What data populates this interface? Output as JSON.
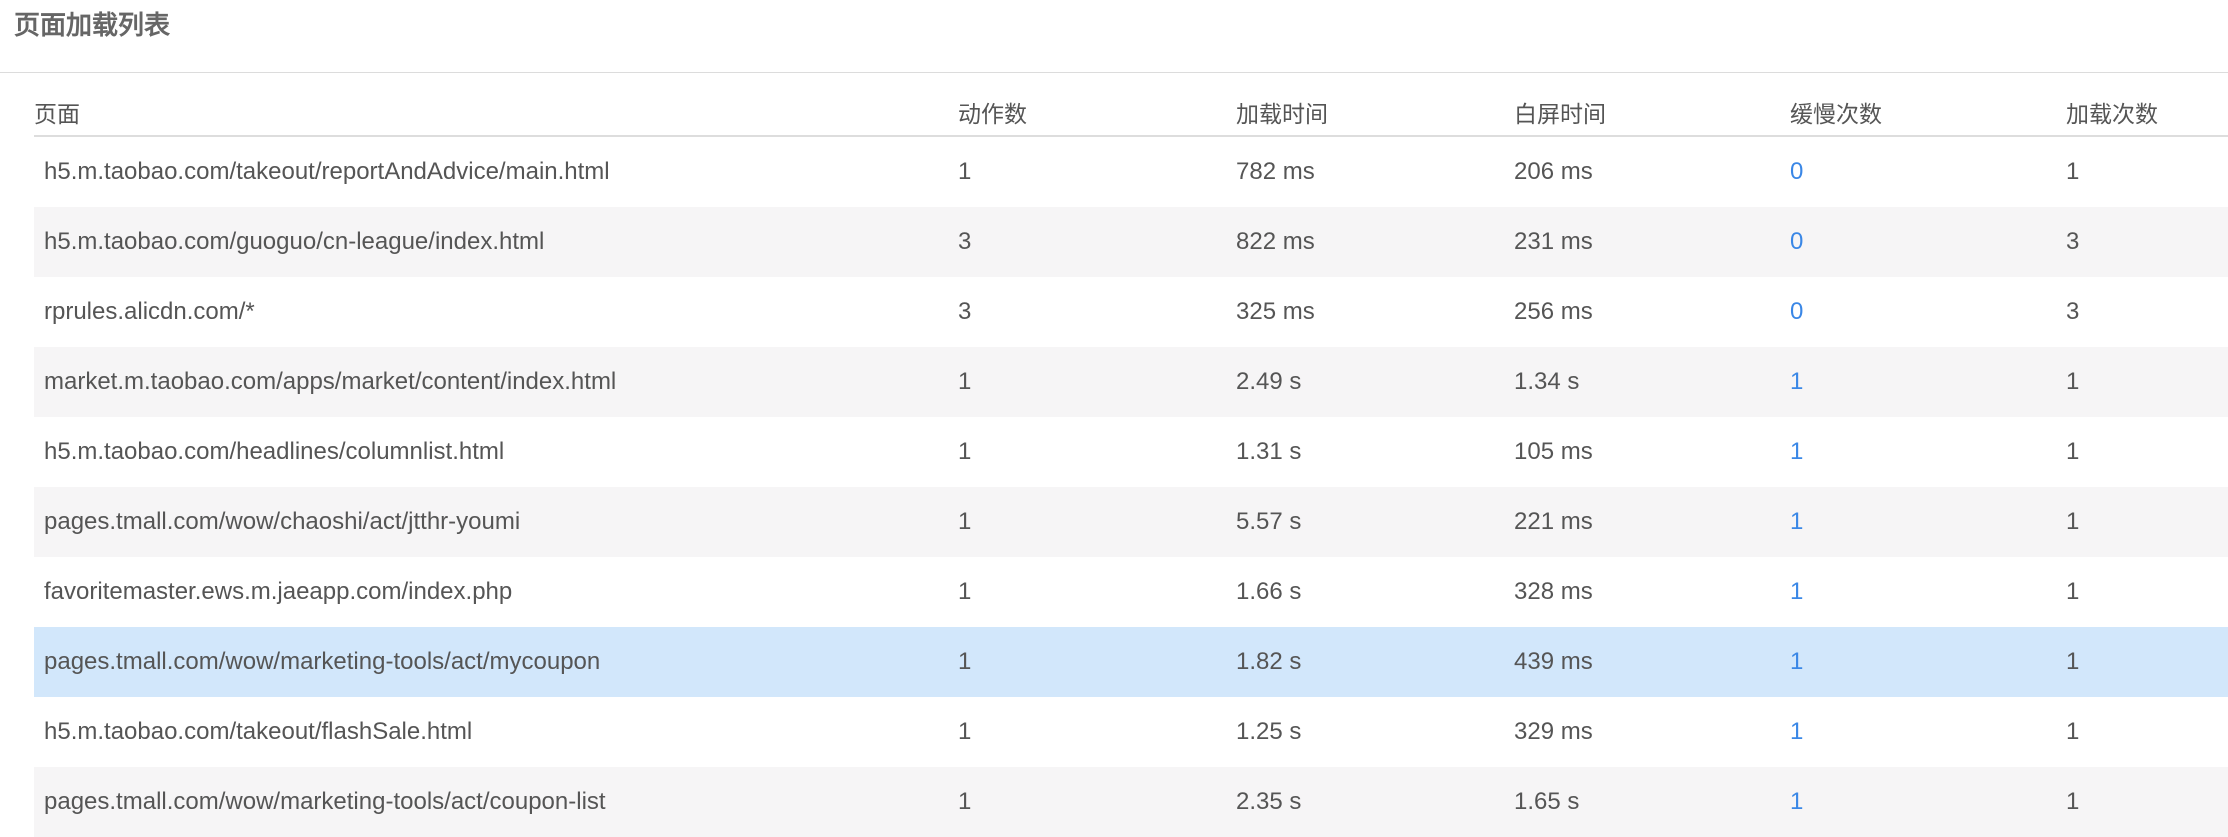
{
  "panel": {
    "title": "页面加载列表"
  },
  "table": {
    "columns": [
      "页面",
      "动作数",
      "加载时间",
      "白屏时间",
      "缓慢次数",
      "加载次数"
    ],
    "rows": [
      {
        "page": "h5.m.taobao.com/takeout/reportAndAdvice/main.html",
        "actions": "1",
        "load_time": "782 ms",
        "white_screen_time": "206 ms",
        "slow_count": "0",
        "load_count": "1"
      },
      {
        "page": "h5.m.taobao.com/guoguo/cn-league/index.html",
        "actions": "3",
        "load_time": "822 ms",
        "white_screen_time": "231 ms",
        "slow_count": "0",
        "load_count": "3"
      },
      {
        "page": "rprules.alicdn.com/*",
        "actions": "3",
        "load_time": "325 ms",
        "white_screen_time": "256 ms",
        "slow_count": "0",
        "load_count": "3"
      },
      {
        "page": "market.m.taobao.com/apps/market/content/index.html",
        "actions": "1",
        "load_time": "2.49 s",
        "white_screen_time": "1.34 s",
        "slow_count": "1",
        "load_count": "1"
      },
      {
        "page": "h5.m.taobao.com/headlines/columnlist.html",
        "actions": "1",
        "load_time": "1.31 s",
        "white_screen_time": "105 ms",
        "slow_count": "1",
        "load_count": "1"
      },
      {
        "page": "pages.tmall.com/wow/chaoshi/act/jtthr-youmi",
        "actions": "1",
        "load_time": "5.57 s",
        "white_screen_time": "221 ms",
        "slow_count": "1",
        "load_count": "1"
      },
      {
        "page": "favoritemaster.ews.m.jaeapp.com/index.php",
        "actions": "1",
        "load_time": "1.66 s",
        "white_screen_time": "328 ms",
        "slow_count": "1",
        "load_count": "1"
      },
      {
        "page": "pages.tmall.com/wow/marketing-tools/act/mycoupon",
        "actions": "1",
        "load_time": "1.82 s",
        "white_screen_time": "439 ms",
        "slow_count": "1",
        "load_count": "1"
      },
      {
        "page": "h5.m.taobao.com/takeout/flashSale.html",
        "actions": "1",
        "load_time": "1.25 s",
        "white_screen_time": "329 ms",
        "slow_count": "1",
        "load_count": "1"
      },
      {
        "page": "pages.tmall.com/wow/marketing-tools/act/coupon-list",
        "actions": "1",
        "load_time": "2.35 s",
        "white_screen_time": "1.65 s",
        "slow_count": "1",
        "load_count": "1"
      }
    ],
    "selected_row_index": 7
  },
  "colors": {
    "link": "#3a87e6",
    "alt_row": "#f6f5f6",
    "selected_row": "#d2e7fb",
    "text": "#555555"
  }
}
